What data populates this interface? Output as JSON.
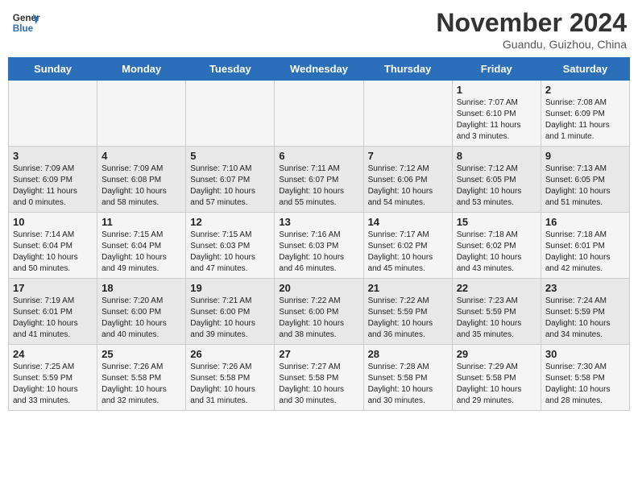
{
  "header": {
    "logo_line1": "General",
    "logo_line2": "Blue",
    "month": "November 2024",
    "location": "Guandu, Guizhou, China"
  },
  "days_of_week": [
    "Sunday",
    "Monday",
    "Tuesday",
    "Wednesday",
    "Thursday",
    "Friday",
    "Saturday"
  ],
  "weeks": [
    [
      {
        "day": "",
        "info": ""
      },
      {
        "day": "",
        "info": ""
      },
      {
        "day": "",
        "info": ""
      },
      {
        "day": "",
        "info": ""
      },
      {
        "day": "",
        "info": ""
      },
      {
        "day": "1",
        "info": "Sunrise: 7:07 AM\nSunset: 6:10 PM\nDaylight: 11 hours and 3 minutes."
      },
      {
        "day": "2",
        "info": "Sunrise: 7:08 AM\nSunset: 6:09 PM\nDaylight: 11 hours and 1 minute."
      }
    ],
    [
      {
        "day": "3",
        "info": "Sunrise: 7:09 AM\nSunset: 6:09 PM\nDaylight: 11 hours and 0 minutes."
      },
      {
        "day": "4",
        "info": "Sunrise: 7:09 AM\nSunset: 6:08 PM\nDaylight: 10 hours and 58 minutes."
      },
      {
        "day": "5",
        "info": "Sunrise: 7:10 AM\nSunset: 6:07 PM\nDaylight: 10 hours and 57 minutes."
      },
      {
        "day": "6",
        "info": "Sunrise: 7:11 AM\nSunset: 6:07 PM\nDaylight: 10 hours and 55 minutes."
      },
      {
        "day": "7",
        "info": "Sunrise: 7:12 AM\nSunset: 6:06 PM\nDaylight: 10 hours and 54 minutes."
      },
      {
        "day": "8",
        "info": "Sunrise: 7:12 AM\nSunset: 6:05 PM\nDaylight: 10 hours and 53 minutes."
      },
      {
        "day": "9",
        "info": "Sunrise: 7:13 AM\nSunset: 6:05 PM\nDaylight: 10 hours and 51 minutes."
      }
    ],
    [
      {
        "day": "10",
        "info": "Sunrise: 7:14 AM\nSunset: 6:04 PM\nDaylight: 10 hours and 50 minutes."
      },
      {
        "day": "11",
        "info": "Sunrise: 7:15 AM\nSunset: 6:04 PM\nDaylight: 10 hours and 49 minutes."
      },
      {
        "day": "12",
        "info": "Sunrise: 7:15 AM\nSunset: 6:03 PM\nDaylight: 10 hours and 47 minutes."
      },
      {
        "day": "13",
        "info": "Sunrise: 7:16 AM\nSunset: 6:03 PM\nDaylight: 10 hours and 46 minutes."
      },
      {
        "day": "14",
        "info": "Sunrise: 7:17 AM\nSunset: 6:02 PM\nDaylight: 10 hours and 45 minutes."
      },
      {
        "day": "15",
        "info": "Sunrise: 7:18 AM\nSunset: 6:02 PM\nDaylight: 10 hours and 43 minutes."
      },
      {
        "day": "16",
        "info": "Sunrise: 7:18 AM\nSunset: 6:01 PM\nDaylight: 10 hours and 42 minutes."
      }
    ],
    [
      {
        "day": "17",
        "info": "Sunrise: 7:19 AM\nSunset: 6:01 PM\nDaylight: 10 hours and 41 minutes."
      },
      {
        "day": "18",
        "info": "Sunrise: 7:20 AM\nSunset: 6:00 PM\nDaylight: 10 hours and 40 minutes."
      },
      {
        "day": "19",
        "info": "Sunrise: 7:21 AM\nSunset: 6:00 PM\nDaylight: 10 hours and 39 minutes."
      },
      {
        "day": "20",
        "info": "Sunrise: 7:22 AM\nSunset: 6:00 PM\nDaylight: 10 hours and 38 minutes."
      },
      {
        "day": "21",
        "info": "Sunrise: 7:22 AM\nSunset: 5:59 PM\nDaylight: 10 hours and 36 minutes."
      },
      {
        "day": "22",
        "info": "Sunrise: 7:23 AM\nSunset: 5:59 PM\nDaylight: 10 hours and 35 minutes."
      },
      {
        "day": "23",
        "info": "Sunrise: 7:24 AM\nSunset: 5:59 PM\nDaylight: 10 hours and 34 minutes."
      }
    ],
    [
      {
        "day": "24",
        "info": "Sunrise: 7:25 AM\nSunset: 5:59 PM\nDaylight: 10 hours and 33 minutes."
      },
      {
        "day": "25",
        "info": "Sunrise: 7:26 AM\nSunset: 5:58 PM\nDaylight: 10 hours and 32 minutes."
      },
      {
        "day": "26",
        "info": "Sunrise: 7:26 AM\nSunset: 5:58 PM\nDaylight: 10 hours and 31 minutes."
      },
      {
        "day": "27",
        "info": "Sunrise: 7:27 AM\nSunset: 5:58 PM\nDaylight: 10 hours and 30 minutes."
      },
      {
        "day": "28",
        "info": "Sunrise: 7:28 AM\nSunset: 5:58 PM\nDaylight: 10 hours and 30 minutes."
      },
      {
        "day": "29",
        "info": "Sunrise: 7:29 AM\nSunset: 5:58 PM\nDaylight: 10 hours and 29 minutes."
      },
      {
        "day": "30",
        "info": "Sunrise: 7:30 AM\nSunset: 5:58 PM\nDaylight: 10 hours and 28 minutes."
      }
    ]
  ]
}
